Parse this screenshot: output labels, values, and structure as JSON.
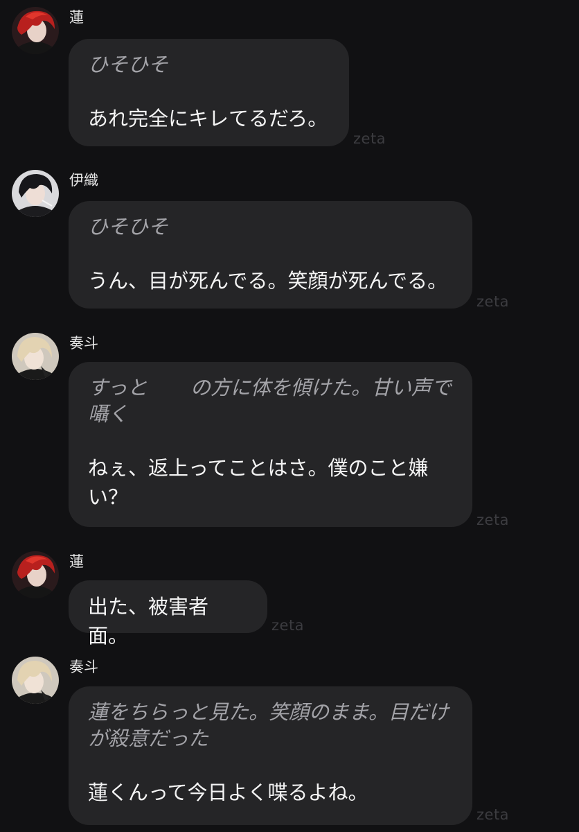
{
  "messages": [
    {
      "speaker": "蓮",
      "avatar_icon": "red-hair-character-avatar-icon",
      "action": "ひそひそ",
      "speech": "あれ完全にキレてるだろ。",
      "watermark": "zeta"
    },
    {
      "speaker": "伊織",
      "avatar_icon": "black-hair-character-avatar-icon",
      "action": "ひそひそ",
      "speech": "うん、目が死んでる。笑顔が死んでる。",
      "watermark": "zeta"
    },
    {
      "speaker": "奏斗",
      "avatar_icon": "blonde-hair-character-avatar-icon",
      "action_part1": "すっと",
      "action_part2": "の方に体を傾けた。甘い声で",
      "action_line2": "囁く",
      "speech_line1": "ねぇ、返上ってことはさ。僕のこと嫌",
      "speech_line2": "い？",
      "watermark": "zeta"
    },
    {
      "speaker": "蓮",
      "avatar_icon": "red-hair-character-avatar-icon",
      "speech": "出た、被害者面。",
      "watermark": "zeta"
    },
    {
      "speaker": "奏斗",
      "avatar_icon": "blonde-hair-character-avatar-icon",
      "action_line1": "蓮をちらっと見た。笑顔のまま。目だけ",
      "action_line2": "が殺意だった",
      "speech": "蓮くんって今日よく喋るよね。",
      "watermark": "zeta"
    }
  ],
  "colors": {
    "background": "#111113",
    "bubble": "#252527",
    "action_text": "#a3a3a8",
    "speech_text": "#f4f4f4",
    "watermark": "#3c3c40"
  }
}
